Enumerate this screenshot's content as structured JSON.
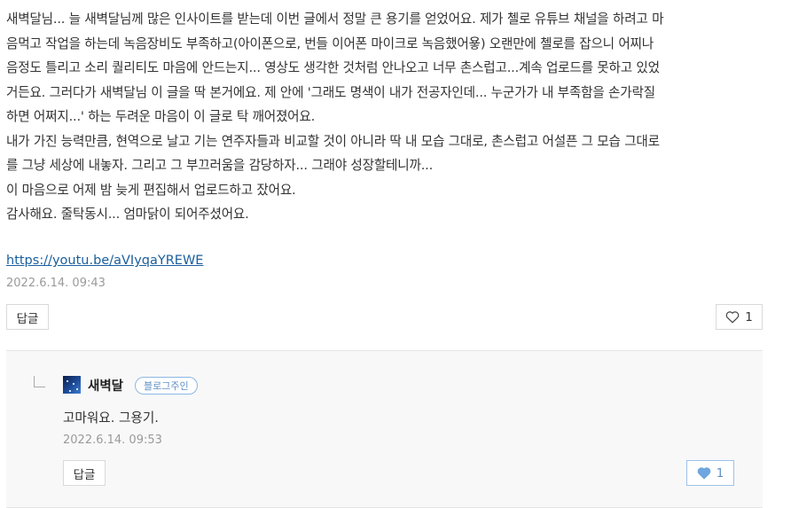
{
  "comment": {
    "lines": [
      "새벽달님... 늘 새벽달님께 많은 인사이트를 받는데 이번 글에서 정말 큰 용기를 얻었어요. 제가 첼로 유튜브 채널을 하려고 마",
      "음먹고 작업을 하는데 녹음장비도 부족하고(아이폰으로, 번들 이어폰 마이크로 녹음했어욯) 오랜만에 첼로를 잡으니 어찌나",
      "음정도 틀리고 소리 퀄리티도 마음에 안드는지... 영상도 생각한 것처럼 안나오고 너무 촌스럽고...계속 업로드를 못하고 있었",
      "거든요. 그러다가 새벽달님 이 글을 딱 본거에요. 제 안에 '그래도 명색이 내가 전공자인데... 누군가가 내 부족함을 손가락질",
      "하면 어쩌지...' 하는 두려운 마음이 이 글로 탁 깨어졌어요.",
      "내가 가진 능력만큼, 현역으로 날고 기는 연주자들과 비교할 것이 아니라 딱 내 모습 그대로, 촌스럽고 어설픈 그 모습 그대로",
      "를 그냥 세상에 내놓자. 그리고 그 부끄러움을 감당하자... 그래야 성장할테니까...",
      "이 마음으로 어제 밤 늦게 편집해서 업로드하고 잤어요.",
      "감사해요. 줄탁동시... 엄마닭이 되어주셨어요."
    ],
    "link": "https://youtu.be/aVIyqaYREWE",
    "date": "2022.6.14. 09:43",
    "reply_button": "답글",
    "like_count": "1"
  },
  "reply": {
    "author": "새벽달",
    "badge": "블로그주인",
    "text": "고마워요. 그용기.",
    "date": "2022.6.14. 09:53",
    "reply_button": "답글",
    "like_count": "1"
  },
  "icons": {
    "comment_like": "heart-outline-icon",
    "reply_like": "heart-filled-icon",
    "reply_marker": "reply-elbow-icon"
  },
  "colors": {
    "link": "#1a5e9e",
    "badge": "#5e8fc4",
    "liked_heart": "#6fa6e0"
  }
}
